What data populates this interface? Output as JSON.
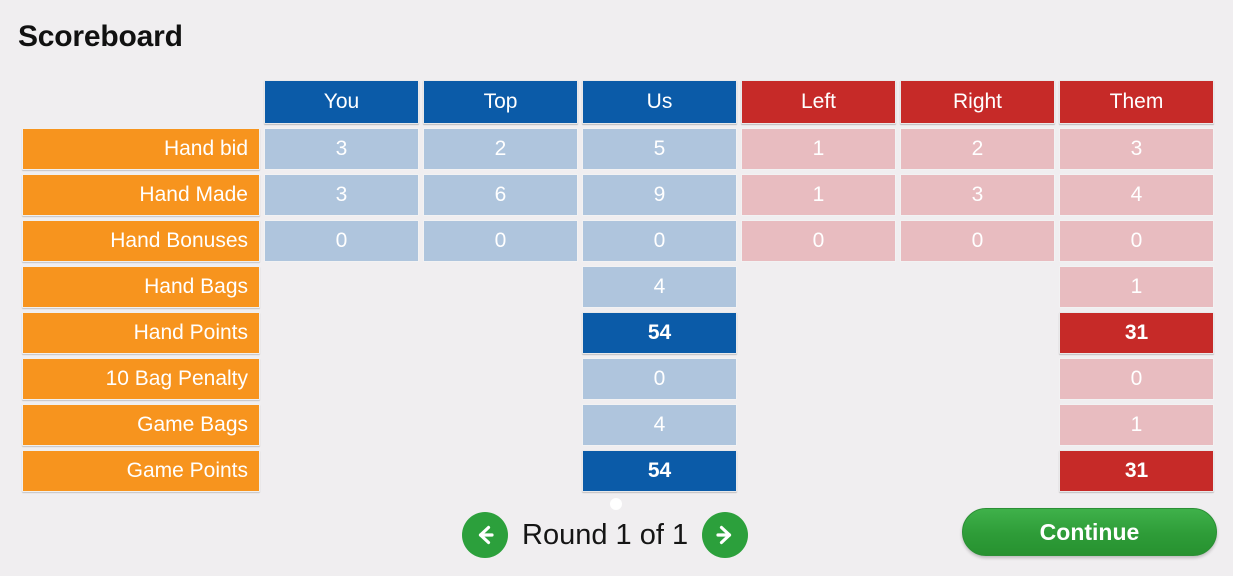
{
  "page_title": "Scoreboard",
  "colors": {
    "background": "#f0eef0",
    "orange_label": "#f7941e",
    "blue_header": "#0b5ba8",
    "blue_light": "#afc5dd",
    "red_header": "#c62a28",
    "red_light": "#e8bcc0",
    "green_button": "#2ca03c"
  },
  "table": {
    "corner_label": "",
    "columns": [
      {
        "label": "You",
        "team": "us",
        "style": "blue"
      },
      {
        "label": "Top",
        "team": "us",
        "style": "blue"
      },
      {
        "label": "Us",
        "team": "us",
        "style": "blue"
      },
      {
        "label": "Left",
        "team": "them",
        "style": "red"
      },
      {
        "label": "Right",
        "team": "them",
        "style": "red"
      },
      {
        "label": "Them",
        "team": "them",
        "style": "red"
      }
    ],
    "rows": [
      {
        "label": "Hand bid",
        "values": [
          "3",
          "2",
          "5",
          "1",
          "2",
          "3"
        ],
        "emphasis": [
          false,
          false,
          false,
          false,
          false,
          false
        ]
      },
      {
        "label": "Hand Made",
        "values": [
          "3",
          "6",
          "9",
          "1",
          "3",
          "4"
        ],
        "emphasis": [
          false,
          false,
          false,
          false,
          false,
          false
        ]
      },
      {
        "label": "Hand Bonuses",
        "values": [
          "0",
          "0",
          "0",
          "0",
          "0",
          "0"
        ],
        "emphasis": [
          false,
          false,
          false,
          false,
          false,
          false
        ]
      },
      {
        "label": "Hand Bags",
        "values": [
          "",
          "",
          "4",
          "",
          "",
          "1"
        ],
        "emphasis": [
          false,
          false,
          false,
          false,
          false,
          false
        ]
      },
      {
        "label": "Hand Points",
        "values": [
          "",
          "",
          "54",
          "",
          "",
          "31"
        ],
        "emphasis": [
          false,
          false,
          true,
          false,
          false,
          true
        ]
      },
      {
        "label": "10 Bag Penalty",
        "values": [
          "",
          "",
          "0",
          "",
          "",
          "0"
        ],
        "emphasis": [
          false,
          false,
          false,
          false,
          false,
          false
        ]
      },
      {
        "label": "Game Bags",
        "values": [
          "",
          "",
          "4",
          "",
          "",
          "1"
        ],
        "emphasis": [
          false,
          false,
          false,
          false,
          false,
          false
        ]
      },
      {
        "label": "Game Points",
        "values": [
          "",
          "",
          "54",
          "",
          "",
          "31"
        ],
        "emphasis": [
          false,
          false,
          true,
          false,
          false,
          true
        ]
      }
    ]
  },
  "footer": {
    "prev_icon": "arrow-left-icon",
    "next_icon": "arrow-right-icon",
    "round_label": "Round 1 of 1",
    "continue_label": "Continue",
    "page_indicator_count": 1,
    "page_indicator_active": 1
  }
}
